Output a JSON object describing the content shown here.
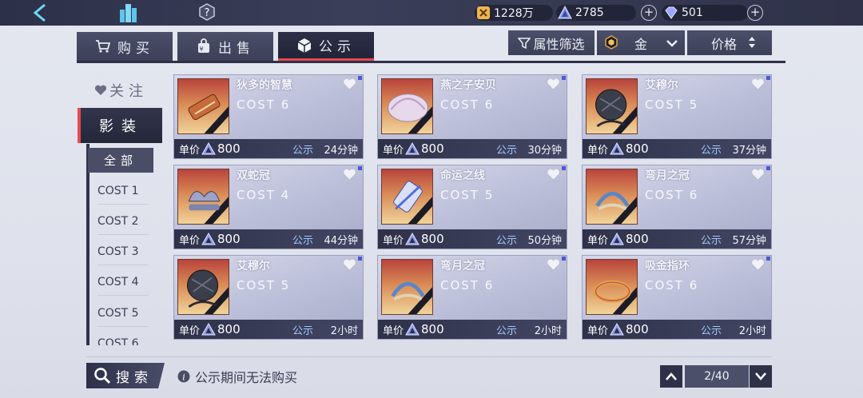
{
  "currency": {
    "coins": "1228万",
    "crystals": "2785",
    "gems": "501"
  },
  "tabs": [
    {
      "label": "购买"
    },
    {
      "label": "出售"
    },
    {
      "label": "公示"
    }
  ],
  "filters": {
    "attr_label": "属性筛选",
    "quality_label": "金",
    "price_label": "价格"
  },
  "sidebar": {
    "follow_label": "关注",
    "main_label": "影装",
    "all_label": "全部",
    "items": [
      "COST 1",
      "COST 2",
      "COST 3",
      "COST 4",
      "COST 5",
      "COST 6"
    ]
  },
  "cards": [
    {
      "name": "狄多的智慧",
      "cost": "COST 6",
      "price_label": "单价",
      "price": "800",
      "status": "公示",
      "time": "24分钟",
      "icon": "scroll-icon"
    },
    {
      "name": "燕之子安贝",
      "cost": "COST 6",
      "price_label": "单价",
      "price": "800",
      "status": "公示",
      "time": "30分钟",
      "icon": "shell-icon"
    },
    {
      "name": "艾穆尔",
      "cost": "COST 5",
      "price_label": "单价",
      "price": "800",
      "status": "公示",
      "time": "37分钟",
      "icon": "mace-icon"
    },
    {
      "name": "双蛇冠",
      "cost": "COST 4",
      "price_label": "单价",
      "price": "800",
      "status": "公示",
      "time": "44分钟",
      "icon": "crown-icon"
    },
    {
      "name": "命运之线",
      "cost": "COST 5",
      "price_label": "单价",
      "price": "800",
      "status": "公示",
      "time": "50分钟",
      "icon": "spool-icon"
    },
    {
      "name": "弯月之冠",
      "cost": "COST 6",
      "price_label": "单价",
      "price": "800",
      "status": "公示",
      "time": "57分钟",
      "icon": "moon-crown-icon"
    },
    {
      "name": "艾穆尔",
      "cost": "COST 5",
      "price_label": "单价",
      "price": "800",
      "status": "公示",
      "time": "2小时",
      "icon": "mace-icon"
    },
    {
      "name": "弯月之冠",
      "cost": "COST 6",
      "price_label": "单价",
      "price": "800",
      "status": "公示",
      "time": "2小时",
      "icon": "moon-crown-icon"
    },
    {
      "name": "吸金指环",
      "cost": "COST 6",
      "price_label": "单价",
      "price": "800",
      "status": "公示",
      "time": "2小时",
      "icon": "ring-icon"
    }
  ],
  "bottom": {
    "search_label": "搜索",
    "notice": "公示期间无法购买",
    "page": "2/40"
  },
  "colors": {
    "accent_red": "#e64a4f",
    "dark_panel": "#2e3147",
    "status_blue": "#9ec8ff"
  }
}
